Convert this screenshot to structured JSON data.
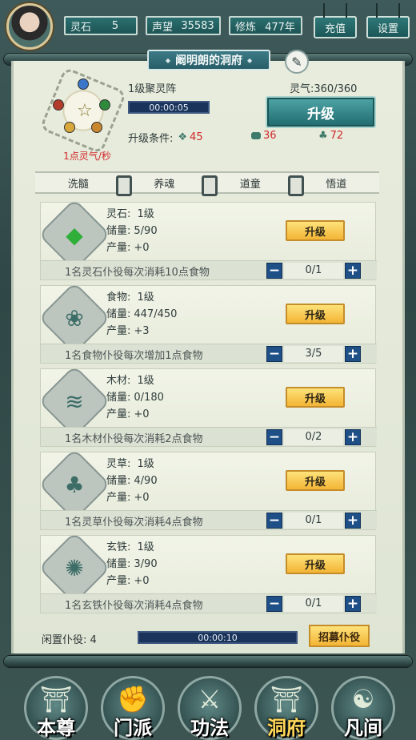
{
  "header": {
    "stats": [
      {
        "label": "灵石",
        "value": "5"
      },
      {
        "label": "声望",
        "value": "35583"
      },
      {
        "label": "修炼",
        "value": "477年"
      }
    ],
    "buttons": {
      "recharge": "充值",
      "settings": "设置"
    }
  },
  "title": "阚明朗的洞府",
  "array": {
    "name": "1级聚灵阵",
    "timer": "00:00:05",
    "timer_progress": 0.0,
    "rate": "1点灵气/秒",
    "lingqi_label": "灵气:",
    "lingqi_value": "360/360",
    "upgrade_label": "升级",
    "conditions_label": "升级条件:",
    "conditions": [
      "45",
      "36",
      "72"
    ]
  },
  "tabs": [
    "洗髓",
    "养魂",
    "道童",
    "悟道"
  ],
  "resources": [
    {
      "name": "灵石",
      "level": "1级",
      "storage": "5/90",
      "output": "+0",
      "upgrade": "升级",
      "cost_text": "1名灵石仆役每次消耗10点食物",
      "workers": "0/1",
      "icon": "spirit-stone-icon",
      "color": "#2fae3a"
    },
    {
      "name": "食物",
      "level": "1级",
      "storage": "447/450",
      "output": "+3",
      "upgrade": "升级",
      "cost_text": "1名食物仆役每次增加1点食物",
      "workers": "3/5",
      "icon": "food-icon",
      "color": "#3c6d66"
    },
    {
      "name": "木材",
      "level": "1级",
      "storage": "0/180",
      "output": "+0",
      "upgrade": "升级",
      "cost_text": "1名木材仆役每次消耗2点食物",
      "workers": "0/2",
      "icon": "wood-icon",
      "color": "#3c6d66"
    },
    {
      "name": "灵草",
      "level": "1级",
      "storage": "4/90",
      "output": "+0",
      "upgrade": "升级",
      "cost_text": "1名灵草仆役每次消耗4点食物",
      "workers": "0/1",
      "icon": "herb-icon",
      "color": "#3c6d66"
    },
    {
      "name": "玄铁",
      "level": "1级",
      "storage": "3/90",
      "output": "+0",
      "upgrade": "升级",
      "cost_text": "1名玄铁仆役每次消耗4点食物",
      "workers": "0/1",
      "icon": "iron-icon",
      "color": "#3c6d66"
    }
  ],
  "labels": {
    "storage": "储量:",
    "output": "产量:",
    "minus": "−",
    "plus": "+"
  },
  "idle": {
    "label": "闲置仆役:",
    "count": "4",
    "timer": "00:00:10",
    "timer_progress": 0.0,
    "recruit": "招募仆役"
  },
  "nav": [
    {
      "label": "本尊",
      "icon": "character-icon",
      "glyph": "☯"
    },
    {
      "label": "门派",
      "icon": "sect-icon",
      "glyph": "✊"
    },
    {
      "label": "功法",
      "icon": "technique-icon",
      "glyph": "⚔"
    },
    {
      "label": "洞府",
      "icon": "cave-icon",
      "glyph": "☯",
      "active": true
    },
    {
      "label": "凡间",
      "icon": "mortal-world-icon",
      "glyph": "☯"
    }
  ]
}
